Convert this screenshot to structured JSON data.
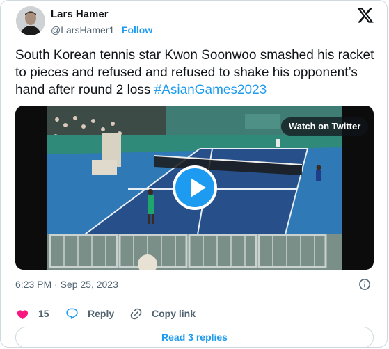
{
  "author": {
    "name": "Lars Hamer",
    "handle": "@LarsHamer1",
    "separator": "·",
    "follow_label": "Follow"
  },
  "tweet": {
    "text": "South Korean tennis star Kwon Soonwoo smashed his racket to pieces and refused and refused to shake his opponent’s hand after round 2 loss ",
    "hashtag": "#AsianGames2023"
  },
  "media": {
    "watch_label": "Watch on Twitter"
  },
  "meta": {
    "timestamp": "6:23 PM · Sep 25, 2023"
  },
  "actions": {
    "likes_count": "15",
    "reply_label": "Reply",
    "copy_label": "Copy link"
  },
  "replies": {
    "read_label": "Read 3 replies"
  },
  "colors": {
    "accent": "#1d9bf0",
    "like": "#f91880",
    "court": "#2f79b6",
    "court_inner": "#274f8a"
  },
  "icons": [
    "x-logo-icon",
    "heart-icon",
    "reply-icon",
    "link-icon",
    "info-icon",
    "play-icon"
  ]
}
